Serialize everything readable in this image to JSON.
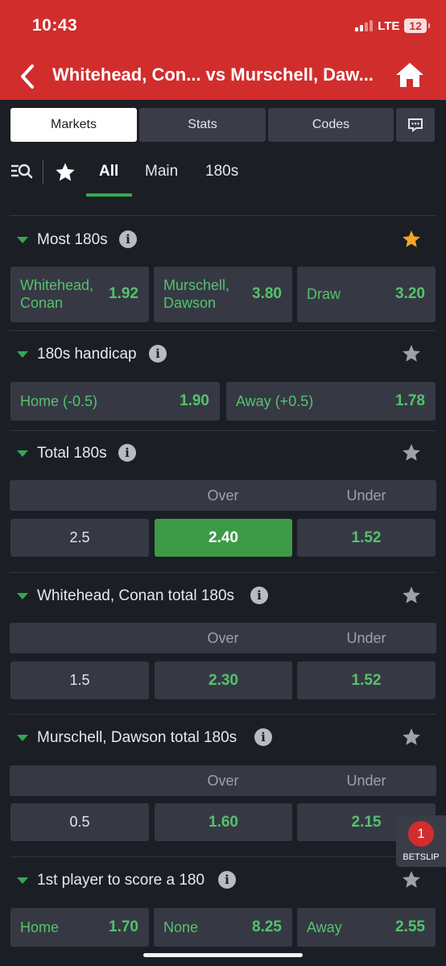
{
  "status": {
    "time": "10:43",
    "network": "LTE",
    "battery": "12"
  },
  "header": {
    "title": "Whitehead, Con... vs Murschell, Daw..."
  },
  "tabs": [
    {
      "label": "Markets"
    },
    {
      "label": "Stats"
    },
    {
      "label": "Codes"
    }
  ],
  "filters": [
    {
      "label": "All"
    },
    {
      "label": "Main"
    },
    {
      "label": "180s"
    }
  ],
  "markets": {
    "most180s": {
      "title": "Most 180s",
      "options": [
        {
          "label": "Whitehead,\nConan",
          "price": "1.92"
        },
        {
          "label": "Murschell,\nDawson",
          "price": "3.80"
        },
        {
          "label": "Draw",
          "price": "3.20"
        }
      ]
    },
    "handicap": {
      "title": "180s handicap",
      "options": [
        {
          "label": "Home (-0.5)",
          "price": "1.90"
        },
        {
          "label": "Away (+0.5)",
          "price": "1.78"
        }
      ]
    },
    "total": {
      "title": "Total 180s",
      "over": "Over",
      "under": "Under",
      "line": "2.5",
      "over_price": "2.40",
      "under_price": "1.52"
    },
    "whitehead_total": {
      "title": "Whitehead, Conan total 180s",
      "over": "Over",
      "under": "Under",
      "line": "1.5",
      "over_price": "2.30",
      "under_price": "1.52"
    },
    "murschell_total": {
      "title": "Murschell, Dawson total 180s",
      "over": "Over",
      "under": "Under",
      "line": "0.5",
      "over_price": "1.60",
      "under_price": "2.15"
    },
    "first180": {
      "title": "1st player to score a 180",
      "options": [
        {
          "label": "Home",
          "price": "1.70"
        },
        {
          "label": "None",
          "price": "8.25"
        },
        {
          "label": "Away",
          "price": "2.55"
        }
      ]
    }
  },
  "betslip": {
    "count": "1",
    "label": "BETSLIP"
  },
  "colors": {
    "header": "#d22d2d",
    "accent": "#33a853",
    "odds": "#55c26d",
    "selected": "#3d9b48",
    "favorite": "#f5a623"
  }
}
